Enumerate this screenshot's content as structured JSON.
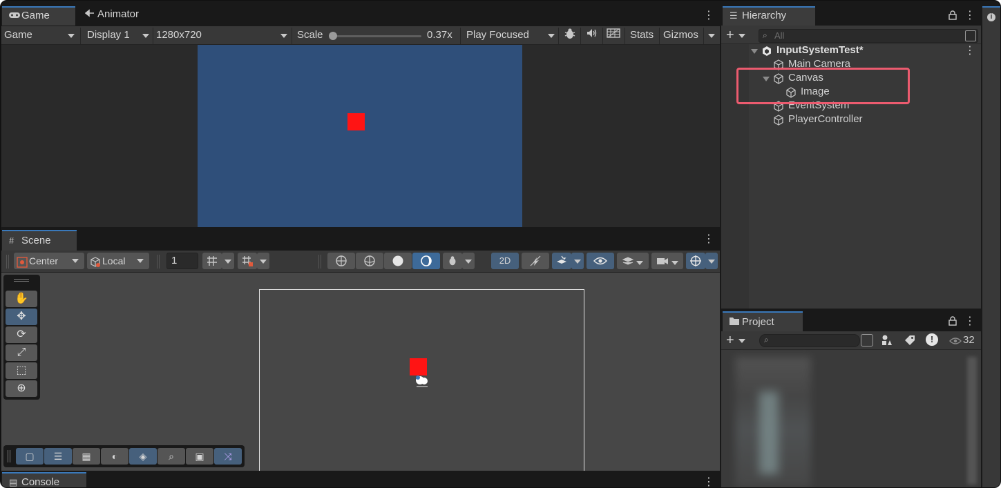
{
  "game_panel": {
    "tabs": [
      {
        "label": "Game",
        "icon": "gamepad-icon"
      },
      {
        "label": "Animator",
        "icon": "animator-icon"
      }
    ],
    "toolbar": {
      "view_mode": "Game",
      "display": "Display 1",
      "resolution": "1280x720",
      "scale_label": "Scale",
      "scale_value": "0.37x",
      "play_mode": "Play Focused",
      "stats_label": "Stats",
      "gizmos_label": "Gizmos"
    },
    "viewport_color": "#2f4f7a",
    "sprite_color": "#ff1414"
  },
  "scene_panel": {
    "tab_label": "Scene",
    "pivot_label": "Center",
    "space_label": "Local",
    "snap_value": "1",
    "mode_2d_label": "2D"
  },
  "console_panel": {
    "tab_label": "Console"
  },
  "hierarchy": {
    "tab_label": "Hierarchy",
    "search_placeholder": "All",
    "scene_name": "InputSystemTest*",
    "items": [
      {
        "label": "Main Camera",
        "depth": 1,
        "expandable": false
      },
      {
        "label": "Canvas",
        "depth": 1,
        "expandable": true
      },
      {
        "label": "Image",
        "depth": 2,
        "expandable": false
      },
      {
        "label": "EventSystem",
        "depth": 1,
        "expandable": false
      },
      {
        "label": "PlayerController",
        "depth": 1,
        "expandable": false
      }
    ],
    "highlight_color": "#ec5b6f"
  },
  "project": {
    "tab_label": "Project",
    "hidden_count": "32"
  },
  "accent_color": "#3a79bb"
}
